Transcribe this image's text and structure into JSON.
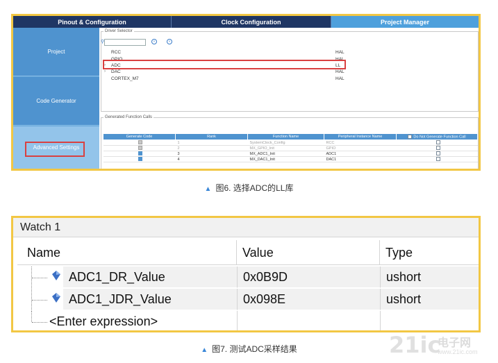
{
  "figure6": {
    "tabs": [
      "Pinout & Configuration",
      "Clock Configuration",
      "Project Manager"
    ],
    "sidebar": [
      "Project",
      "Code Generator",
      "Advanced Settings"
    ],
    "driver_selector": {
      "title": "Driver Selector",
      "rows": [
        {
          "name": "RCC",
          "driver": "HAL"
        },
        {
          "name": "GPIO",
          "driver": "HAL"
        },
        {
          "name": "ADC",
          "driver": "LL"
        },
        {
          "name": "DAC",
          "driver": "HAL"
        },
        {
          "name": "CORTEX_M7",
          "driver": "HAL"
        }
      ]
    },
    "generated_calls": {
      "title": "Generated Function Calls",
      "headers": [
        "Generate Code",
        "Rank",
        "Function Name",
        "Peripheral Instance Name",
        "Do Not Generate Function Call"
      ],
      "rows": [
        {
          "rank": "1",
          "function": "SystemClock_Config",
          "instance": "RCC"
        },
        {
          "rank": "2",
          "function": "MX_GPIO_Init",
          "instance": "GPIO"
        },
        {
          "rank": "3",
          "function": "MX_ADC1_Init",
          "instance": "ADC1"
        },
        {
          "rank": "4",
          "function": "MX_DAC1_Init",
          "instance": "DAC1"
        }
      ]
    }
  },
  "caption6": "图6. 选择ADC的LL库",
  "figure7": {
    "title": "Watch 1",
    "headers": {
      "name": "Name",
      "value": "Value",
      "type": "Type"
    },
    "rows": [
      {
        "name": "ADC1_DR_Value",
        "value": "0x0B9D",
        "type": "ushort"
      },
      {
        "name": "ADC1_JDR_Value",
        "value": "0x098E",
        "type": "ushort"
      }
    ],
    "enter_expression": "<Enter expression>"
  },
  "caption7": "图7. 测试ADC采样结果",
  "watermark": {
    "big": "21ic",
    "cn": "电子网",
    "url": "www.21ic.com"
  },
  "colors": {
    "accent_border": "#f2c744",
    "nav_dark": "#1f3664",
    "nav_active": "#4ea0dc",
    "highlight": "#d94040"
  }
}
